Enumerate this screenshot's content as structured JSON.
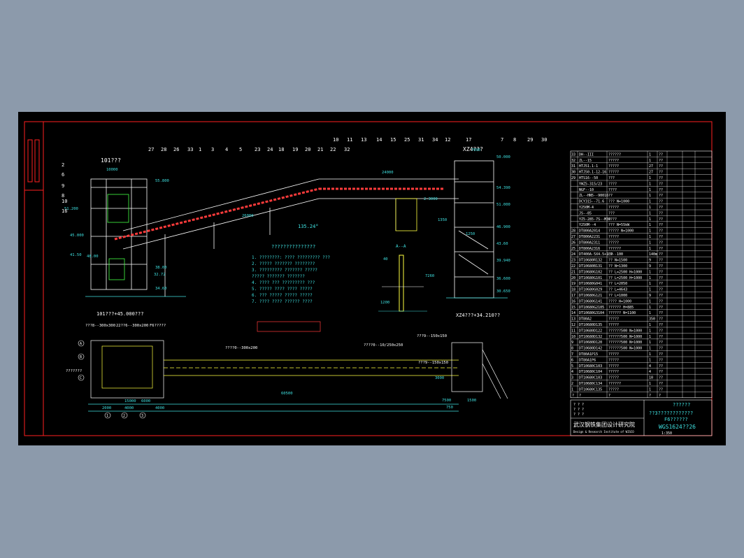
{
  "elevation_view": {
    "title": "101???",
    "section_ref": "XZ4???",
    "elevations": [
      "50.000",
      "54.390",
      "51.000",
      "46.900",
      "43.60",
      "39.940",
      "36.600",
      "30.650",
      "55.800",
      "51.200",
      "48.00",
      "45.000",
      "41.50",
      "38.00",
      "32.72",
      "34.60"
    ],
    "dims": [
      "10000",
      "7000",
      "24000",
      "26000",
      "2-3000",
      "1350",
      "1250"
    ],
    "callouts_top": [
      "27",
      "28",
      "26",
      "1",
      "3",
      "4",
      "5",
      "23",
      "24",
      "18",
      "19",
      "20",
      "21",
      "22",
      "10",
      "11",
      "13",
      "14",
      "15",
      "25",
      "31",
      "34",
      "12",
      "17",
      "7",
      "8",
      "29",
      "30",
      "32",
      "33"
    ],
    "callouts_left": [
      "2",
      "6",
      "9",
      "8",
      "10",
      "16"
    ],
    "slope": "135.24°"
  },
  "plan_view": {
    "title": "101???+45.000???",
    "section_ref": "XZ4???+34.210??",
    "labels": [
      "???8--300x300",
      "22??6--300x200",
      "F6?????",
      "???????",
      "????0--300x200",
      "????0--10/250x250",
      "???9--150x150",
      "???9--150x150"
    ],
    "dims": [
      "15000",
      "6000",
      "2000",
      "4000",
      "4000",
      "60500",
      "3000",
      "7500",
      "750",
      "1500"
    ],
    "axis_marks": [
      "A",
      "B",
      "C",
      "1",
      "2",
      "3"
    ]
  },
  "notes": {
    "title": "???????????????",
    "lines": [
      "1. ????????: ????   ????????? ???",
      "2. ????? ??????? ????????",
      "3. ????????? ??????? ?????",
      "   ????? ??????? ???????",
      "4. ???? ??? ????????? ???",
      "5. ????? ???? ???? ?????",
      "6. ??? ????? ????? ?????",
      "7. ???? ???? ?????? ????"
    ]
  },
  "section_aa": {
    "title": "A--A",
    "dims": [
      "40",
      "7260",
      "1200"
    ]
  },
  "bom": {
    "rows": [
      {
        "n": "33",
        "code": "DH--III",
        "desc": "??????",
        "q": "1",
        "m": "??"
      },
      {
        "n": "32",
        "code": "ZL--15",
        "desc": "?????",
        "q": "1",
        "m": "??"
      },
      {
        "n": "31",
        "code": "HTJ51.1-1",
        "desc": "?????",
        "q": "27",
        "m": "??"
      },
      {
        "n": "30",
        "code": "HTJ50.1-12-16",
        "desc": "?????",
        "q": "27",
        "m": "??"
      },
      {
        "n": "29",
        "code": "HTS16--50",
        "desc": "???",
        "q": "1",
        "m": "??"
      },
      {
        "n": "",
        "code": "YWZ5-315/23",
        "desc": "????",
        "q": "1",
        "m": "??"
      },
      {
        "n": "",
        "code": "NGF--10",
        "desc": "????",
        "q": "1",
        "m": "??"
      },
      {
        "n": "",
        "code": "ZL--HN5--90016",
        "desc": "??",
        "q": "1",
        "m": "??"
      },
      {
        "n": "",
        "code": "DCY315--71.6",
        "desc": "??? N=1000",
        "q": "1",
        "m": "??"
      },
      {
        "n": "",
        "code": "Y250M-4",
        "desc": "?????",
        "q": "1",
        "m": "??"
      },
      {
        "n": "",
        "code": "JS--85",
        "desc": "???",
        "q": "1",
        "m": "??"
      },
      {
        "n": "",
        "code": "YZ5-285-7S--M30",
        "desc": "????",
        "q": "1",
        "m": "??"
      },
      {
        "n": "",
        "code": "Y250M--4",
        "desc": "??? N=55kW",
        "q": "1",
        "m": "??"
      },
      {
        "n": "28",
        "code": "DT800A2014",
        "desc": "????? N=1000",
        "q": "1",
        "m": "??"
      },
      {
        "n": "27",
        "code": "DT800A2231",
        "desc": "?????",
        "q": "1",
        "m": "??"
      },
      {
        "n": "26",
        "code": "DT800A2311",
        "desc": "?????",
        "q": "1",
        "m": "??"
      },
      {
        "n": "25",
        "code": "DT800A2316",
        "desc": "??????",
        "q": "1",
        "m": "??"
      },
      {
        "n": "24",
        "code": "DT400A-5X4.5+1.0",
        "desc": "EP--100",
        "q": "140m",
        "m": "??"
      },
      {
        "n": "23",
        "code": "DT10680R132",
        "desc": "?? N=1500",
        "q": "9",
        "m": "??"
      },
      {
        "n": "22",
        "code": "DT10680B131",
        "desc": "?? N=1300",
        "q": "9",
        "m": "??"
      },
      {
        "n": "21",
        "code": "DT10680G102",
        "desc": "?? L=2500 H=1000",
        "q": "1",
        "m": "??"
      },
      {
        "n": "20",
        "code": "DT10680G101",
        "desc": "?? L=2500 H=1000",
        "q": "1",
        "m": "??"
      },
      {
        "n": "19",
        "code": "DT10680G041",
        "desc": "?? L=2050",
        "q": "1",
        "m": "??"
      },
      {
        "n": "18",
        "code": "DT10680G029",
        "desc": "?? L=4643",
        "q": "1",
        "m": "??"
      },
      {
        "n": "17",
        "code": "DT10680G121",
        "desc": "?? L=1000",
        "q": "9",
        "m": "??"
      },
      {
        "n": "16",
        "code": "DT10680G141",
        "desc": "???? H=1000",
        "q": "1",
        "m": "??"
      },
      {
        "n": "15",
        "code": "DT10680G2105",
        "desc": "?????? H=885",
        "q": "1",
        "m": "??"
      },
      {
        "n": "14",
        "code": "DT10680G3104",
        "desc": "?????? N=1100",
        "q": "1",
        "m": "??"
      },
      {
        "n": "13",
        "code": "DT80A2",
        "desc": "?????",
        "q": "350",
        "m": "??"
      },
      {
        "n": "12",
        "code": "DT10680D135",
        "desc": "?????",
        "q": "1",
        "m": "??"
      },
      {
        "n": "11",
        "code": "DT10680D122",
        "desc": "??????500 N=1000",
        "q": "1",
        "m": "??"
      },
      {
        "n": "10",
        "code": "DT10680D132",
        "desc": "??????500 N=1000",
        "q": "1",
        "m": "??"
      },
      {
        "n": "9",
        "code": "DT10680D120",
        "desc": "??????500 N=1000",
        "q": "1",
        "m": "??"
      },
      {
        "n": "8",
        "code": "DT10680D142",
        "desc": "??????500 N=1000",
        "q": "1",
        "m": "??"
      },
      {
        "n": "7",
        "code": "DT80A1P15",
        "desc": "?????",
        "q": "1",
        "m": "??"
      },
      {
        "n": "6",
        "code": "DT80A1P6",
        "desc": "?????",
        "q": "1",
        "m": "??"
      },
      {
        "n": "5",
        "code": "DT10680C103",
        "desc": "?????",
        "q": "4",
        "m": "??"
      },
      {
        "n": "4",
        "code": "DT10680C104",
        "desc": "?????",
        "q": "4",
        "m": "??"
      },
      {
        "n": "3",
        "code": "DT10680C103",
        "desc": "?????",
        "q": "10",
        "m": "??"
      },
      {
        "n": "2",
        "code": "DT10680C134",
        "desc": "??????",
        "q": "1",
        "m": "??"
      },
      {
        "n": "1",
        "code": "DT10680C135",
        "desc": "?????",
        "q": "1",
        "m": "??"
      }
    ],
    "header": [
      "?",
      "?",
      "?",
      "?",
      "?"
    ]
  },
  "title_block": {
    "institute": "武汉钢铁集团设计研究院",
    "institute_en": "Design & Research Institute of WISCO",
    "project": "??????",
    "drawing_title": "??3????????????",
    "equipment": "F6??????",
    "drawing_no": "WGS1624??26",
    "scale": "1:350",
    "rows_left": [
      "? ? ?",
      "? ? ?",
      "? ? ?"
    ]
  },
  "colors": {
    "background": "#000000",
    "frame": "#ff2020",
    "outer": "#8c9aab",
    "cyan": "#3fe0e0",
    "white": "#ffffff",
    "yellow": "#ffff40",
    "green": "#44ff44",
    "red": "#ff3b3b"
  }
}
